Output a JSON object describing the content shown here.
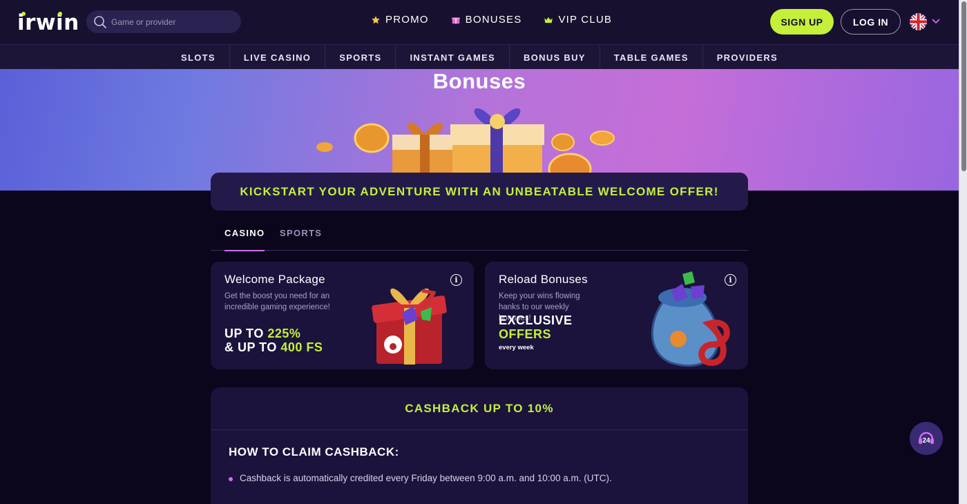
{
  "header": {
    "logo": "irwin",
    "search_placeholder": "Game or provider",
    "nav": [
      {
        "label": "PROMO",
        "icon": "star-icon"
      },
      {
        "label": "BONUSES",
        "icon": "gift-icon"
      },
      {
        "label": "VIP CLUB",
        "icon": "crown-icon"
      }
    ],
    "signup_label": "SIGN UP",
    "login_label": "LOG IN",
    "language_icon": "uk-flag-icon"
  },
  "categories": [
    "SLOTS",
    "LIVE CASINO",
    "SPORTS",
    "INSTANT GAMES",
    "BONUS BUY",
    "TABLE GAMES",
    "PROVIDERS"
  ],
  "hero": {
    "title": "Bonuses"
  },
  "promo_banner": "KICKSTART YOUR ADVENTURE WITH AN UNBEATABLE WELCOME OFFER!",
  "tabs": [
    {
      "label": "CASINO",
      "active": true
    },
    {
      "label": "SPORTS",
      "active": false
    }
  ],
  "cards": {
    "welcome": {
      "title": "Welcome Package",
      "desc": "Get the boost you need for an incredible gaming experience!",
      "line1_prefix": "UP TO ",
      "line1_value": "225%",
      "line2_prefix": "& UP TO ",
      "line2_value": "400 FS"
    },
    "reload": {
      "title": "Reload Bonuses",
      "desc": "Keep your wins flowing hanks to our weekly bonuses!",
      "line1": "EXCLUSIVE",
      "line2": "OFFERS",
      "note": "every week"
    }
  },
  "cashback": {
    "heading": "CASHBACK UP TO 10%",
    "subheading": "HOW TO CLAIM CASHBACK:",
    "items": [
      "Cashback is automatically credited every Friday between 9:00 a.m. and 10:00 a.m. (UTC)."
    ]
  },
  "support": {
    "label": "24"
  },
  "colors": {
    "accent": "#c4f03a",
    "tab_underline": "#d06ef0",
    "card_bg": "#1b133c"
  }
}
